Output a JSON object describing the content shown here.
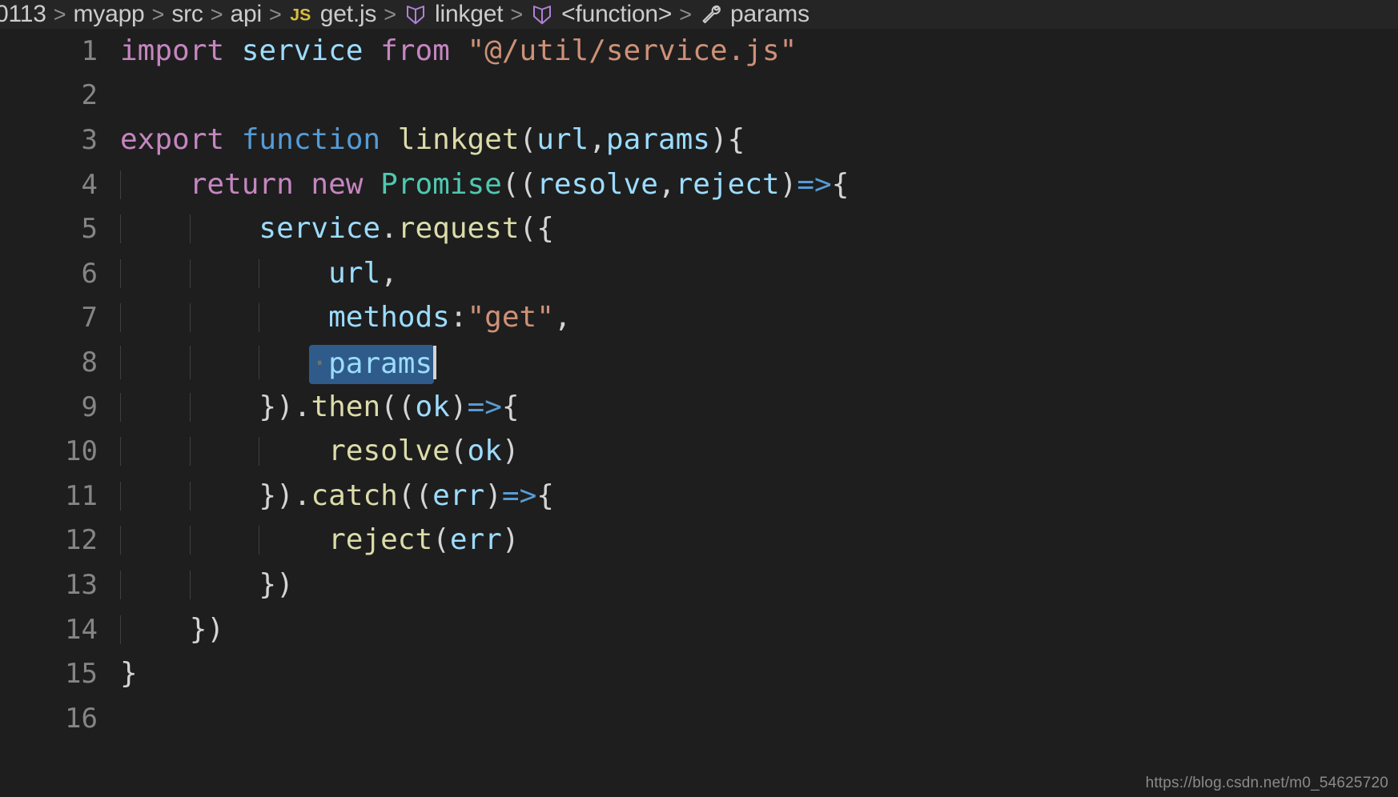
{
  "breadcrumb": {
    "items": [
      {
        "label": "0113",
        "icon": "none"
      },
      {
        "label": "myapp",
        "icon": "none"
      },
      {
        "label": "src",
        "icon": "none"
      },
      {
        "label": "api",
        "icon": "none"
      },
      {
        "label": "get.js",
        "icon": "js-file-icon"
      },
      {
        "label": "linkget",
        "icon": "symbol-module-icon"
      },
      {
        "label": "<function>",
        "icon": "symbol-module-icon"
      },
      {
        "label": "params",
        "icon": "symbol-property-icon"
      }
    ],
    "separator": ">"
  },
  "editor": {
    "language": "JavaScript",
    "file": "get.js",
    "cursor_line": 8,
    "selection_text": "params",
    "colors": {
      "background": "#1e1e1e",
      "breadcrumb_background": "#252526",
      "line_number": "#858585",
      "selection": "#2e5b8a",
      "caret": "#d4d4d4",
      "indent_guide": "#404040",
      "keyword": "#c586c0",
      "variable": "#9cdcfe",
      "string": "#ce9178",
      "function_keyword": "#569cd6",
      "function_name": "#dcdcaa",
      "class_name": "#4ec9b0",
      "punctuation": "#d4d4d4"
    },
    "lines": [
      {
        "number": "1",
        "indent_guides": 0,
        "tokens": [
          {
            "text": "import ",
            "type": "keyword"
          },
          {
            "text": "service ",
            "type": "variable"
          },
          {
            "text": "from ",
            "type": "keyword"
          },
          {
            "text": "\"@/util/service.js\"",
            "type": "string"
          }
        ]
      },
      {
        "number": "2",
        "indent_guides": 0,
        "tokens": []
      },
      {
        "number": "3",
        "indent_guides": 0,
        "tokens": [
          {
            "text": "export ",
            "type": "keyword"
          },
          {
            "text": "function ",
            "type": "function_keyword"
          },
          {
            "text": "linkget",
            "type": "function_name"
          },
          {
            "text": "(",
            "type": "punctuation"
          },
          {
            "text": "url",
            "type": "variable"
          },
          {
            "text": ",",
            "type": "punctuation"
          },
          {
            "text": "params",
            "type": "variable"
          },
          {
            "text": "){",
            "type": "punctuation"
          }
        ]
      },
      {
        "number": "4",
        "indent_guides": 1,
        "tokens": [
          {
            "text": "    ",
            "type": "punctuation"
          },
          {
            "text": "return ",
            "type": "keyword"
          },
          {
            "text": "new ",
            "type": "keyword"
          },
          {
            "text": "Promise",
            "type": "class_name"
          },
          {
            "text": "((",
            "type": "punctuation"
          },
          {
            "text": "resolve",
            "type": "variable"
          },
          {
            "text": ",",
            "type": "punctuation"
          },
          {
            "text": "reject",
            "type": "variable"
          },
          {
            "text": ")",
            "type": "punctuation"
          },
          {
            "text": "=>",
            "type": "function_keyword"
          },
          {
            "text": "{",
            "type": "punctuation"
          }
        ]
      },
      {
        "number": "5",
        "indent_guides": 2,
        "tokens": [
          {
            "text": "        ",
            "type": "punctuation"
          },
          {
            "text": "service",
            "type": "variable"
          },
          {
            "text": ".",
            "type": "punctuation"
          },
          {
            "text": "request",
            "type": "function_name"
          },
          {
            "text": "({",
            "type": "punctuation"
          }
        ]
      },
      {
        "number": "6",
        "indent_guides": 3,
        "tokens": [
          {
            "text": "            ",
            "type": "punctuation"
          },
          {
            "text": "url",
            "type": "variable"
          },
          {
            "text": ",",
            "type": "punctuation"
          }
        ]
      },
      {
        "number": "7",
        "indent_guides": 3,
        "tokens": [
          {
            "text": "            ",
            "type": "punctuation"
          },
          {
            "text": "methods",
            "type": "variable"
          },
          {
            "text": ":",
            "type": "punctuation"
          },
          {
            "text": "\"get\"",
            "type": "string"
          },
          {
            "text": ",",
            "type": "punctuation"
          }
        ]
      },
      {
        "number": "8",
        "indent_guides": 3,
        "selected": true,
        "tokens": [
          {
            "text": "           ",
            "type": "punctuation"
          },
          {
            "text": "·params",
            "type": "selection"
          }
        ]
      },
      {
        "number": "9",
        "indent_guides": 2,
        "tokens": [
          {
            "text": "        ",
            "type": "punctuation"
          },
          {
            "text": "})",
            "type": "punctuation"
          },
          {
            "text": ".",
            "type": "punctuation"
          },
          {
            "text": "then",
            "type": "function_name"
          },
          {
            "text": "((",
            "type": "punctuation"
          },
          {
            "text": "ok",
            "type": "variable"
          },
          {
            "text": ")",
            "type": "punctuation"
          },
          {
            "text": "=>",
            "type": "function_keyword"
          },
          {
            "text": "{",
            "type": "punctuation"
          }
        ]
      },
      {
        "number": "10",
        "indent_guides": 3,
        "tokens": [
          {
            "text": "            ",
            "type": "punctuation"
          },
          {
            "text": "resolve",
            "type": "function_name"
          },
          {
            "text": "(",
            "type": "punctuation"
          },
          {
            "text": "ok",
            "type": "variable"
          },
          {
            "text": ")",
            "type": "punctuation"
          }
        ]
      },
      {
        "number": "11",
        "indent_guides": 2,
        "tokens": [
          {
            "text": "        ",
            "type": "punctuation"
          },
          {
            "text": "})",
            "type": "punctuation"
          },
          {
            "text": ".",
            "type": "punctuation"
          },
          {
            "text": "catch",
            "type": "function_name"
          },
          {
            "text": "((",
            "type": "punctuation"
          },
          {
            "text": "err",
            "type": "variable"
          },
          {
            "text": ")",
            "type": "punctuation"
          },
          {
            "text": "=>",
            "type": "function_keyword"
          },
          {
            "text": "{",
            "type": "punctuation"
          }
        ]
      },
      {
        "number": "12",
        "indent_guides": 3,
        "tokens": [
          {
            "text": "            ",
            "type": "punctuation"
          },
          {
            "text": "reject",
            "type": "function_name"
          },
          {
            "text": "(",
            "type": "punctuation"
          },
          {
            "text": "err",
            "type": "variable"
          },
          {
            "text": ")",
            "type": "punctuation"
          }
        ]
      },
      {
        "number": "13",
        "indent_guides": 2,
        "tokens": [
          {
            "text": "        ",
            "type": "punctuation"
          },
          {
            "text": "})",
            "type": "punctuation"
          }
        ]
      },
      {
        "number": "14",
        "indent_guides": 1,
        "tokens": [
          {
            "text": "    ",
            "type": "punctuation"
          },
          {
            "text": "})",
            "type": "punctuation"
          }
        ]
      },
      {
        "number": "15",
        "indent_guides": 0,
        "tokens": [
          {
            "text": "}",
            "type": "punctuation"
          }
        ]
      },
      {
        "number": "16",
        "indent_guides": 0,
        "tokens": []
      }
    ]
  },
  "watermark": {
    "text": "https://blog.csdn.net/m0_54625720"
  }
}
